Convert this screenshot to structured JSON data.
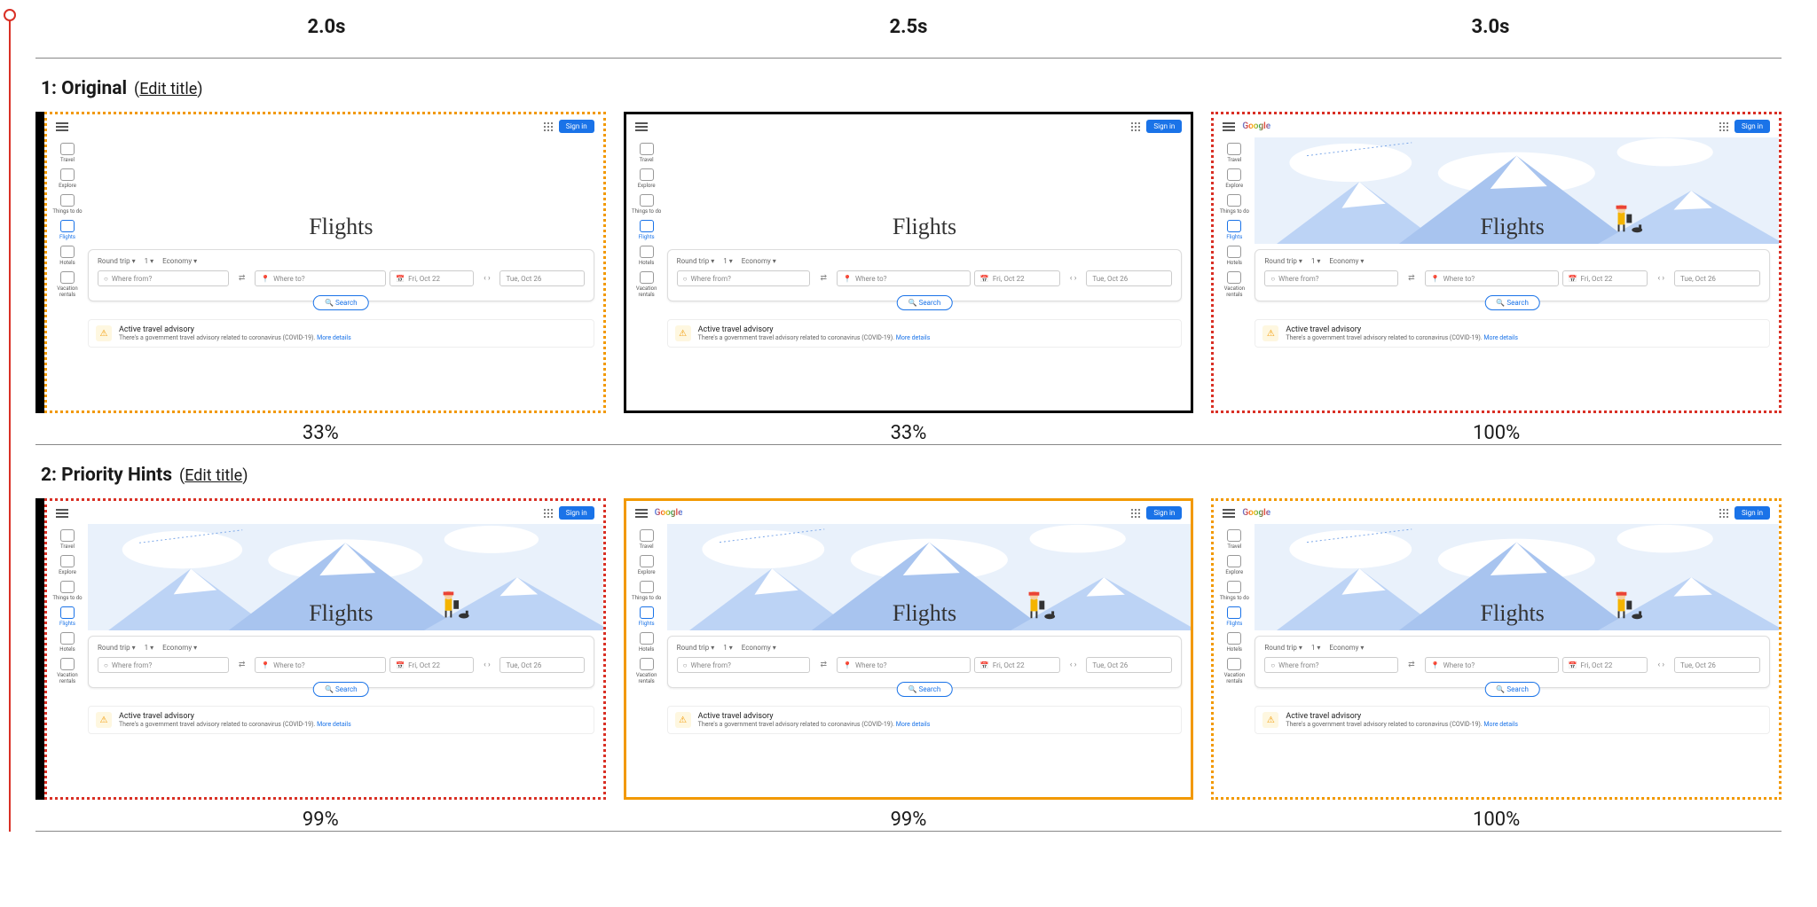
{
  "header_times": [
    "2.0s",
    "2.5s",
    "3.0s"
  ],
  "rows": [
    {
      "index": "1",
      "title_prefix": "1: ",
      "title": "Original",
      "edit_label": "Edit title",
      "frames": [
        {
          "percent": "33%",
          "border": "b-orange-dotted",
          "handle": true,
          "hero": false,
          "logo": false
        },
        {
          "percent": "33%",
          "border": "b-black-solid",
          "handle": false,
          "hero": false,
          "logo": false
        },
        {
          "percent": "100%",
          "border": "b-red-dotted",
          "handle": false,
          "hero": true,
          "logo": true
        }
      ]
    },
    {
      "index": "2",
      "title_prefix": "2: ",
      "title": "Priority Hints",
      "edit_label": "Edit title",
      "frames": [
        {
          "percent": "99%",
          "border": "b-red-dotted",
          "handle": true,
          "hero": true,
          "logo": false
        },
        {
          "percent": "99%",
          "border": "b-orange-solid",
          "handle": false,
          "hero": true,
          "logo": true
        },
        {
          "percent": "100%",
          "border": "b-orange-dotted",
          "handle": false,
          "hero": true,
          "logo": true
        }
      ]
    }
  ],
  "flights": {
    "logo_text": "Google",
    "signin": "Sign in",
    "heading": "Flights",
    "sidebar": [
      {
        "label": "Travel"
      },
      {
        "label": "Explore"
      },
      {
        "label": "Things to do"
      },
      {
        "label": "Flights",
        "blue": true
      },
      {
        "label": "Hotels"
      },
      {
        "label": "Vacation rentals"
      }
    ],
    "chips": {
      "trip": "Round trip",
      "pax": "1",
      "class": "Economy"
    },
    "fields": {
      "from_placeholder": "Where from?",
      "to_placeholder": "Where to?",
      "date1": "Fri, Oct 22",
      "date2": "Tue, Oct 26"
    },
    "search_label": "Search",
    "advisory": {
      "title": "Active travel advisory",
      "sub": "There's a government travel advisory related to coronavirus (COVID-19).",
      "more": "More details"
    }
  }
}
